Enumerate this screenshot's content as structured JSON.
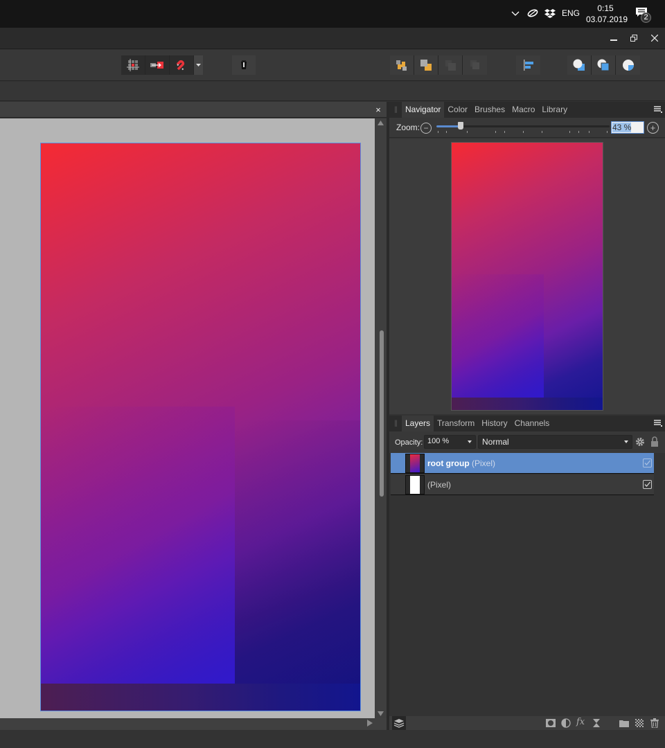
{
  "taskbar": {
    "language": "ENG",
    "time": "0:15",
    "date": "03.07.2019",
    "notification_count": "2",
    "icons": [
      "chevron-up-icon",
      "leaf-app-icon",
      "dropbox-icon",
      "action-center-icon"
    ]
  },
  "window": {
    "controls": {
      "minimize": "minimize",
      "restore": "restore",
      "close": "close"
    }
  },
  "toolbar": {
    "snapping_group": [
      "snapping-grid-icon",
      "snap-to-object-icon",
      "magnet-snapping-icon",
      "snapping-dropdown-icon"
    ],
    "assistant_icon": "assistant-icon",
    "arrange_group": [
      "move-forward-icon",
      "bring-to-front-icon",
      "move-back-icon",
      "send-to-back-icon"
    ],
    "align_icon": "align-left-icon",
    "boolean_group": [
      "add-boolean-icon",
      "subtract-boolean-icon",
      "intersect-boolean-icon"
    ]
  },
  "document": {
    "close_symbol": "×",
    "artboard": {
      "gradient_start": "#f52a33",
      "gradient_mid": "#9a2284",
      "gradient_end": "#131590"
    }
  },
  "navigator_panel": {
    "tabs": [
      {
        "label": "Navigator",
        "active": true
      },
      {
        "label": "Color",
        "active": false
      },
      {
        "label": "Brushes",
        "active": false
      },
      {
        "label": "Macro",
        "active": false
      },
      {
        "label": "Library",
        "active": false
      }
    ],
    "zoom_label": "Zoom:",
    "zoom_value": "43 %",
    "zoom_slider_fraction": 0.14
  },
  "layers_panel": {
    "tabs": [
      {
        "label": "Layers",
        "active": true
      },
      {
        "label": "Transform",
        "active": false
      },
      {
        "label": "History",
        "active": false
      },
      {
        "label": "Channels",
        "active": false
      }
    ],
    "opacity_label": "Opacity:",
    "opacity_value": "100 %",
    "blend_mode": "Normal",
    "layers": [
      {
        "name": "root group",
        "type": "(Pixel)",
        "selected": true,
        "visible": true
      },
      {
        "name": "",
        "type": "(Pixel)",
        "selected": false,
        "visible": true
      }
    ],
    "footer_icons": [
      "layers-stack-icon",
      "mask-icon",
      "adjustment-icon",
      "fx-icon",
      "live-filter-icon",
      "group-folder-icon",
      "add-pixel-layer-icon",
      "delete-icon"
    ]
  }
}
